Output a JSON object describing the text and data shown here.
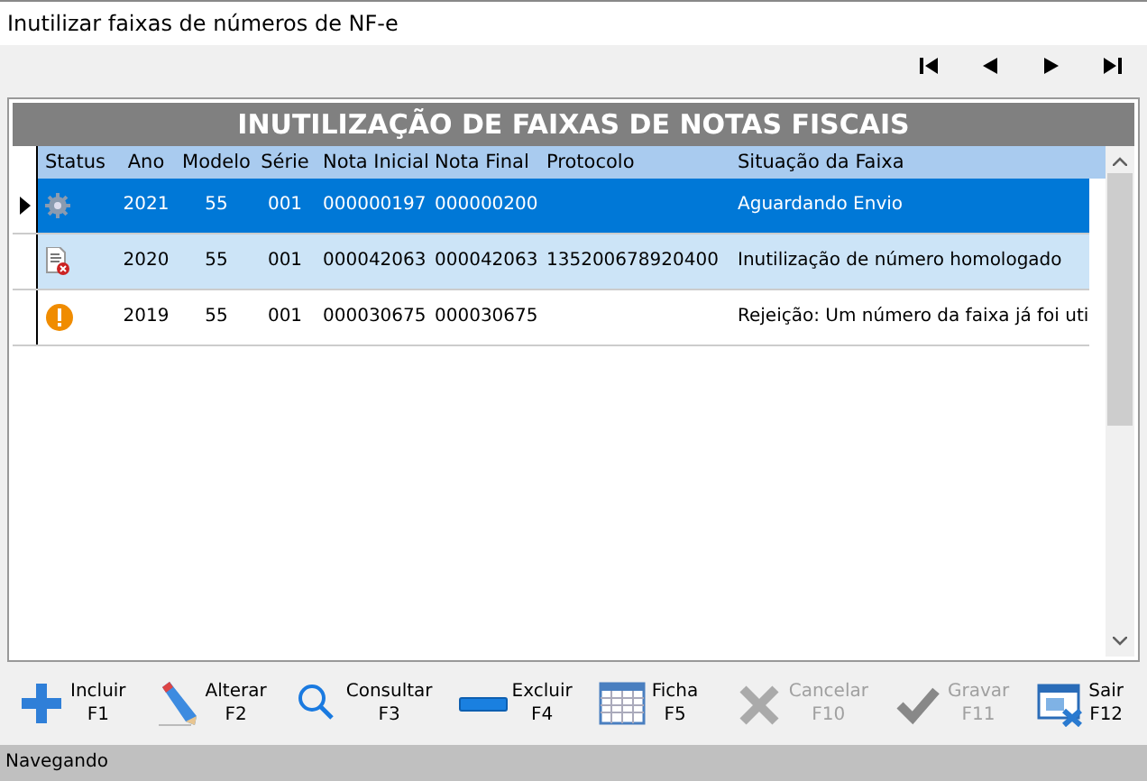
{
  "window": {
    "title": "Inutilizar faixas de números de NF-e"
  },
  "navigator": [
    {
      "kind": "first"
    },
    {
      "kind": "prev"
    },
    {
      "kind": "next"
    },
    {
      "kind": "last"
    }
  ],
  "grid": {
    "title": "INUTILIZAÇÃO DE FAIXAS DE NOTAS FISCAIS",
    "columns": [
      "Status",
      "Ano",
      "Modelo",
      "Série",
      "Nota Inicial",
      "Nota Final",
      "Protocolo",
      "Situação da Faixa"
    ],
    "rows": [
      {
        "selected": true,
        "kind": "gear",
        "cells": [
          "",
          "2021",
          "55",
          "001",
          "000000197",
          "000000200",
          "",
          "Aguardando Envio"
        ]
      },
      {
        "selected": false,
        "kind": "document",
        "cells": [
          "",
          "2020",
          "55",
          "001",
          "000042063",
          "000042063",
          "135200678920400",
          "Inutilização de número homologado"
        ]
      },
      {
        "selected": false,
        "kind": "warning",
        "cells": [
          "",
          "2019",
          "55",
          "001",
          "000030675",
          "000030675",
          "",
          "Rejeição: Um número da faixa já foi uti"
        ]
      }
    ]
  },
  "toolbar": [
    {
      "kind": "plus",
      "label": "Incluir",
      "key": "F1",
      "disabled": false
    },
    {
      "kind": "pencil",
      "label": "Alterar",
      "key": "F2",
      "disabled": false
    },
    {
      "kind": "search",
      "label": "Consultar",
      "key": "F3",
      "disabled": false
    },
    {
      "kind": "minus",
      "label": "Excluir",
      "key": "F4",
      "disabled": false
    },
    {
      "kind": "grid",
      "label": "Ficha",
      "key": "F5",
      "disabled": false
    },
    {
      "kind": "cross",
      "label": "Cancelar",
      "key": "F10",
      "disabled": true
    },
    {
      "kind": "check",
      "label": "Gravar",
      "key": "F11",
      "disabled": true
    },
    {
      "kind": "exit",
      "label": "Sair",
      "key": "F12",
      "disabled": false
    }
  ],
  "status_bar": {
    "text": "Navegando"
  }
}
